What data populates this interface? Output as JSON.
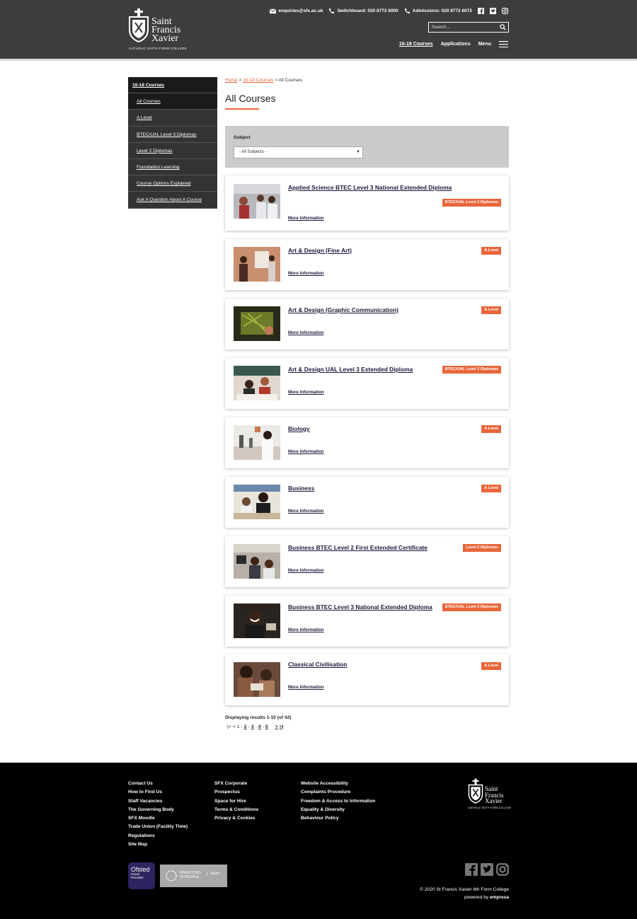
{
  "header": {
    "logo_line1": "Saint",
    "logo_line2": "Francis",
    "logo_line3": "Xavier",
    "logo_sub": "CATHOLIC SIXTH FORM COLLEGE",
    "email": "enquiries@sfx.ac.uk",
    "switchboard": "Switchboard: 020 8772 6000",
    "admissions": "Admissions: 020 8772 6072",
    "search_placeholder": "Search...",
    "nav": {
      "courses": "16-18 Courses",
      "applications": "Applications",
      "menu": "Menu"
    }
  },
  "sidebar": {
    "heading": "16-18 Courses",
    "items": [
      "All Courses",
      "A Level",
      "BTEC/UAL Level 3 Diplomas",
      "Level 2 Diplomas",
      "Foundation Learning",
      "Course Options Explained",
      "Ask A Question About A Course"
    ]
  },
  "breadcrumb": {
    "home": "Home",
    "sep1": " > ",
    "courses": "16-18 Courses",
    "sep2": " > ",
    "current": "All Courses"
  },
  "page_title": "All Courses",
  "filter": {
    "label": "Subject",
    "selected": "- All Subjects -",
    "arrow": "▼"
  },
  "courses": [
    {
      "title": "Applied Science BTEC Level 3 National Extended Diploma",
      "badge": "BTEC/UAL Level 3 Diplomas",
      "more": "More Information"
    },
    {
      "title": "Art & Design (Fine Art)",
      "badge": "A Level",
      "more": "More Information"
    },
    {
      "title": "Art & Design (Graphic Communication)",
      "badge": "A Level",
      "more": "More Information"
    },
    {
      "title": "Art & Design UAL Level 3 Extended Diploma",
      "badge": "BTEC/UAL Level 3 Diplomas",
      "more": "More Information"
    },
    {
      "title": "Biology",
      "badge": "A Level",
      "more": "More Information"
    },
    {
      "title": "Business",
      "badge": "A Level",
      "more": "More Information"
    },
    {
      "title": "Business BTEC Level 2 First Extended Certificate",
      "badge": "Level 2 Diplomas",
      "more": "More Information"
    },
    {
      "title": "Business BTEC Level 3 National Extended Diploma",
      "badge": "BTEC/UAL Level 3 Diplomas",
      "more": "More Information"
    },
    {
      "title": "Classical Civilisation",
      "badge": "A Level",
      "more": "More Information"
    }
  ],
  "results_text": "Displaying results 1-10 (of 42)",
  "pager": {
    "first": "|<",
    "prev": "<",
    "p1": "1",
    "p2": "2",
    "p3": "3",
    "p4": "4",
    "p5": "5",
    "dash": "-",
    "next": ">",
    "last": ">|"
  },
  "footer": {
    "col1": [
      "Contact Us",
      "How to Find Us",
      "Staff Vacancies",
      "The Governing Body",
      "SFX Moodle",
      "Trade Union (Facility Time)",
      "Regulations",
      "Site Map"
    ],
    "col2": [
      "SFX Corporate",
      "Prospectus",
      "Space for Hire",
      "Terms & Conditions",
      "Privacy & Cookies"
    ],
    "col3": [
      "Website Accessibility",
      "Complaints Procedure",
      "Freedom & Access to Information",
      "Equality & Diversity",
      "Behaviour Policy"
    ],
    "ofsted_title": "Ofsted",
    "ofsted_line1": "Good",
    "ofsted_line2": "Provider",
    "iip_line1": "INVESTORS",
    "iip_line2": "IN PEOPLE",
    "iip_level": "Silver",
    "copyright": "© 2020 St Francis Xavier 6th Form College",
    "powered_prefix": "powered by ",
    "powered_brand": "empresa"
  },
  "colors": {
    "accent": "#e8663a",
    "header_bg": "#3d3d3d",
    "sidebar_bg": "#333333",
    "footer_bg": "#000000"
  }
}
